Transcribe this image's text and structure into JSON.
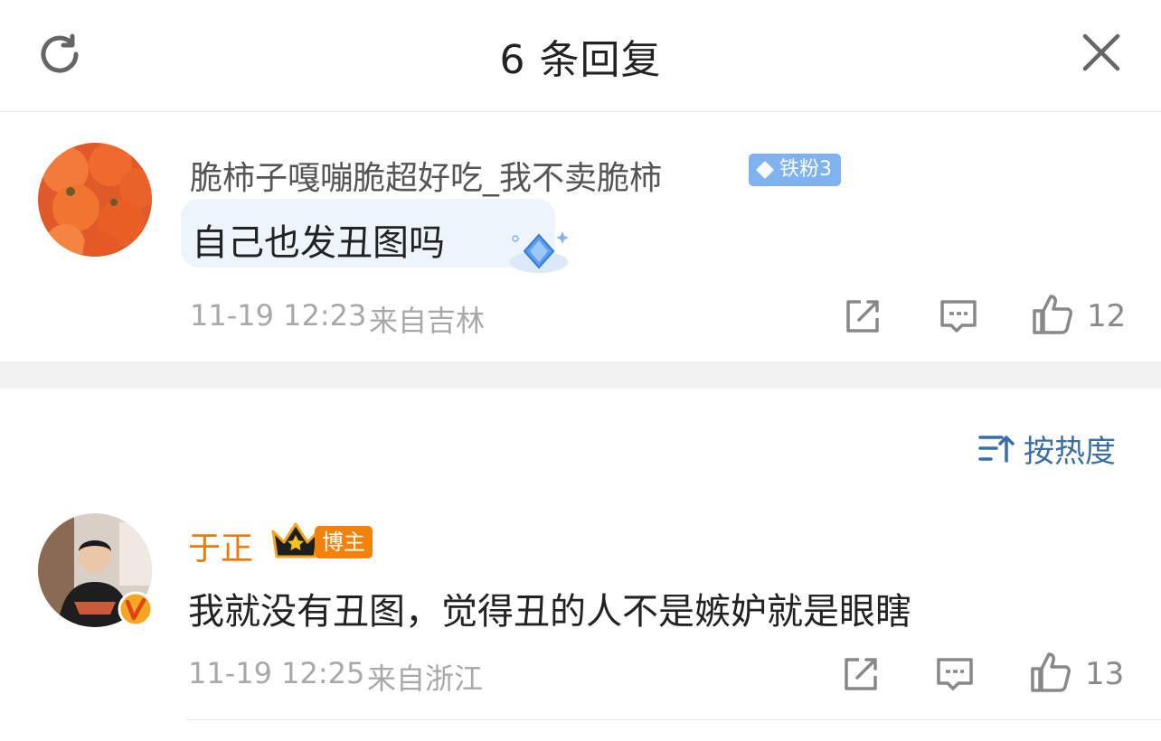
{
  "header": {
    "title": "6 条回复"
  },
  "reply1": {
    "username": "脆柿子嘎嘣脆超好吃_我不卖脆柿",
    "badge": "铁粉3",
    "content": "自己也发丑图吗",
    "time": "11-19 12:23",
    "location": "来自吉林",
    "likes": "12"
  },
  "sort": {
    "label": "按热度"
  },
  "reply2": {
    "username": "于正",
    "badge": "博主",
    "content": "我就没有丑图，觉得丑的人不是嫉妒就是眼瞎",
    "time": "11-19 12:25",
    "location": "来自浙江",
    "likes": "13"
  },
  "colors": {
    "fan_badge": "#7fb3f0",
    "author_name": "#f07800",
    "author_badge": "#f3820a",
    "sort_link": "#3a6ea5"
  }
}
